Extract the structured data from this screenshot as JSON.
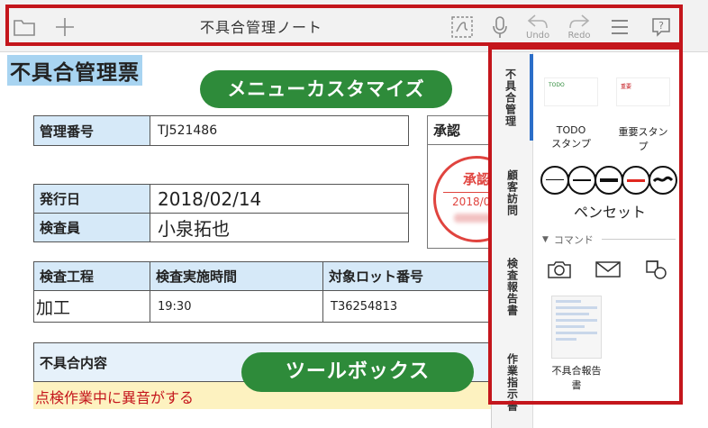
{
  "toolbar": {
    "title": "不具合管理ノート",
    "undo_label": "Undo",
    "redo_label": "Redo",
    "icons": [
      "folder-icon",
      "plus-icon",
      "handwriting-icon",
      "microphone-icon",
      "undo-icon",
      "redo-icon",
      "menu-icon",
      "help-icon"
    ]
  },
  "document": {
    "title": "不具合管理票",
    "callout_menu": "メニューカスタマイズ",
    "callout_toolbox": "ツールボックス",
    "management_no": {
      "label": "管理番号",
      "value": "TJ521486"
    },
    "approval": {
      "label": "承認"
    },
    "seal": {
      "text": "承認",
      "date": "2018/02/"
    },
    "issue_date": {
      "label": "発行日",
      "value": "2018/02/14"
    },
    "inspector": {
      "label": "検査員",
      "value": "小泉拓也"
    },
    "table": {
      "headers": [
        "検査工程",
        "検査実施時間",
        "対象ロット番号"
      ],
      "row": [
        "加工",
        "19:30",
        "T36254813"
      ]
    },
    "defect": {
      "label": "不具合内容",
      "value": "点検作業中に異音がする"
    }
  },
  "panel": {
    "tabs": [
      "不具合管理",
      "顧客訪問",
      "検査報告書",
      "作業指示書"
    ],
    "active_tab": 0,
    "stamps": [
      {
        "label": "TODO\nスタンプ",
        "thumb_text": "TODO"
      },
      {
        "label": "重要スタン\nプ",
        "thumb_text": "重要"
      }
    ],
    "penset_label": "ペンセット",
    "pen_colors": [
      "#111111",
      "#111111",
      "#111111",
      "#e0271f",
      "#111111"
    ],
    "command_header": "コマンド",
    "command_icons": [
      "camera-icon",
      "mail-icon",
      "shapes-icon"
    ],
    "report_label": "不具合報告\n書"
  },
  "colors": {
    "frame_red": "#c4161c",
    "callout_green": "#2e8b3a",
    "label_blue": "#d6e9f8",
    "active_tab": "#2b6ec8"
  }
}
